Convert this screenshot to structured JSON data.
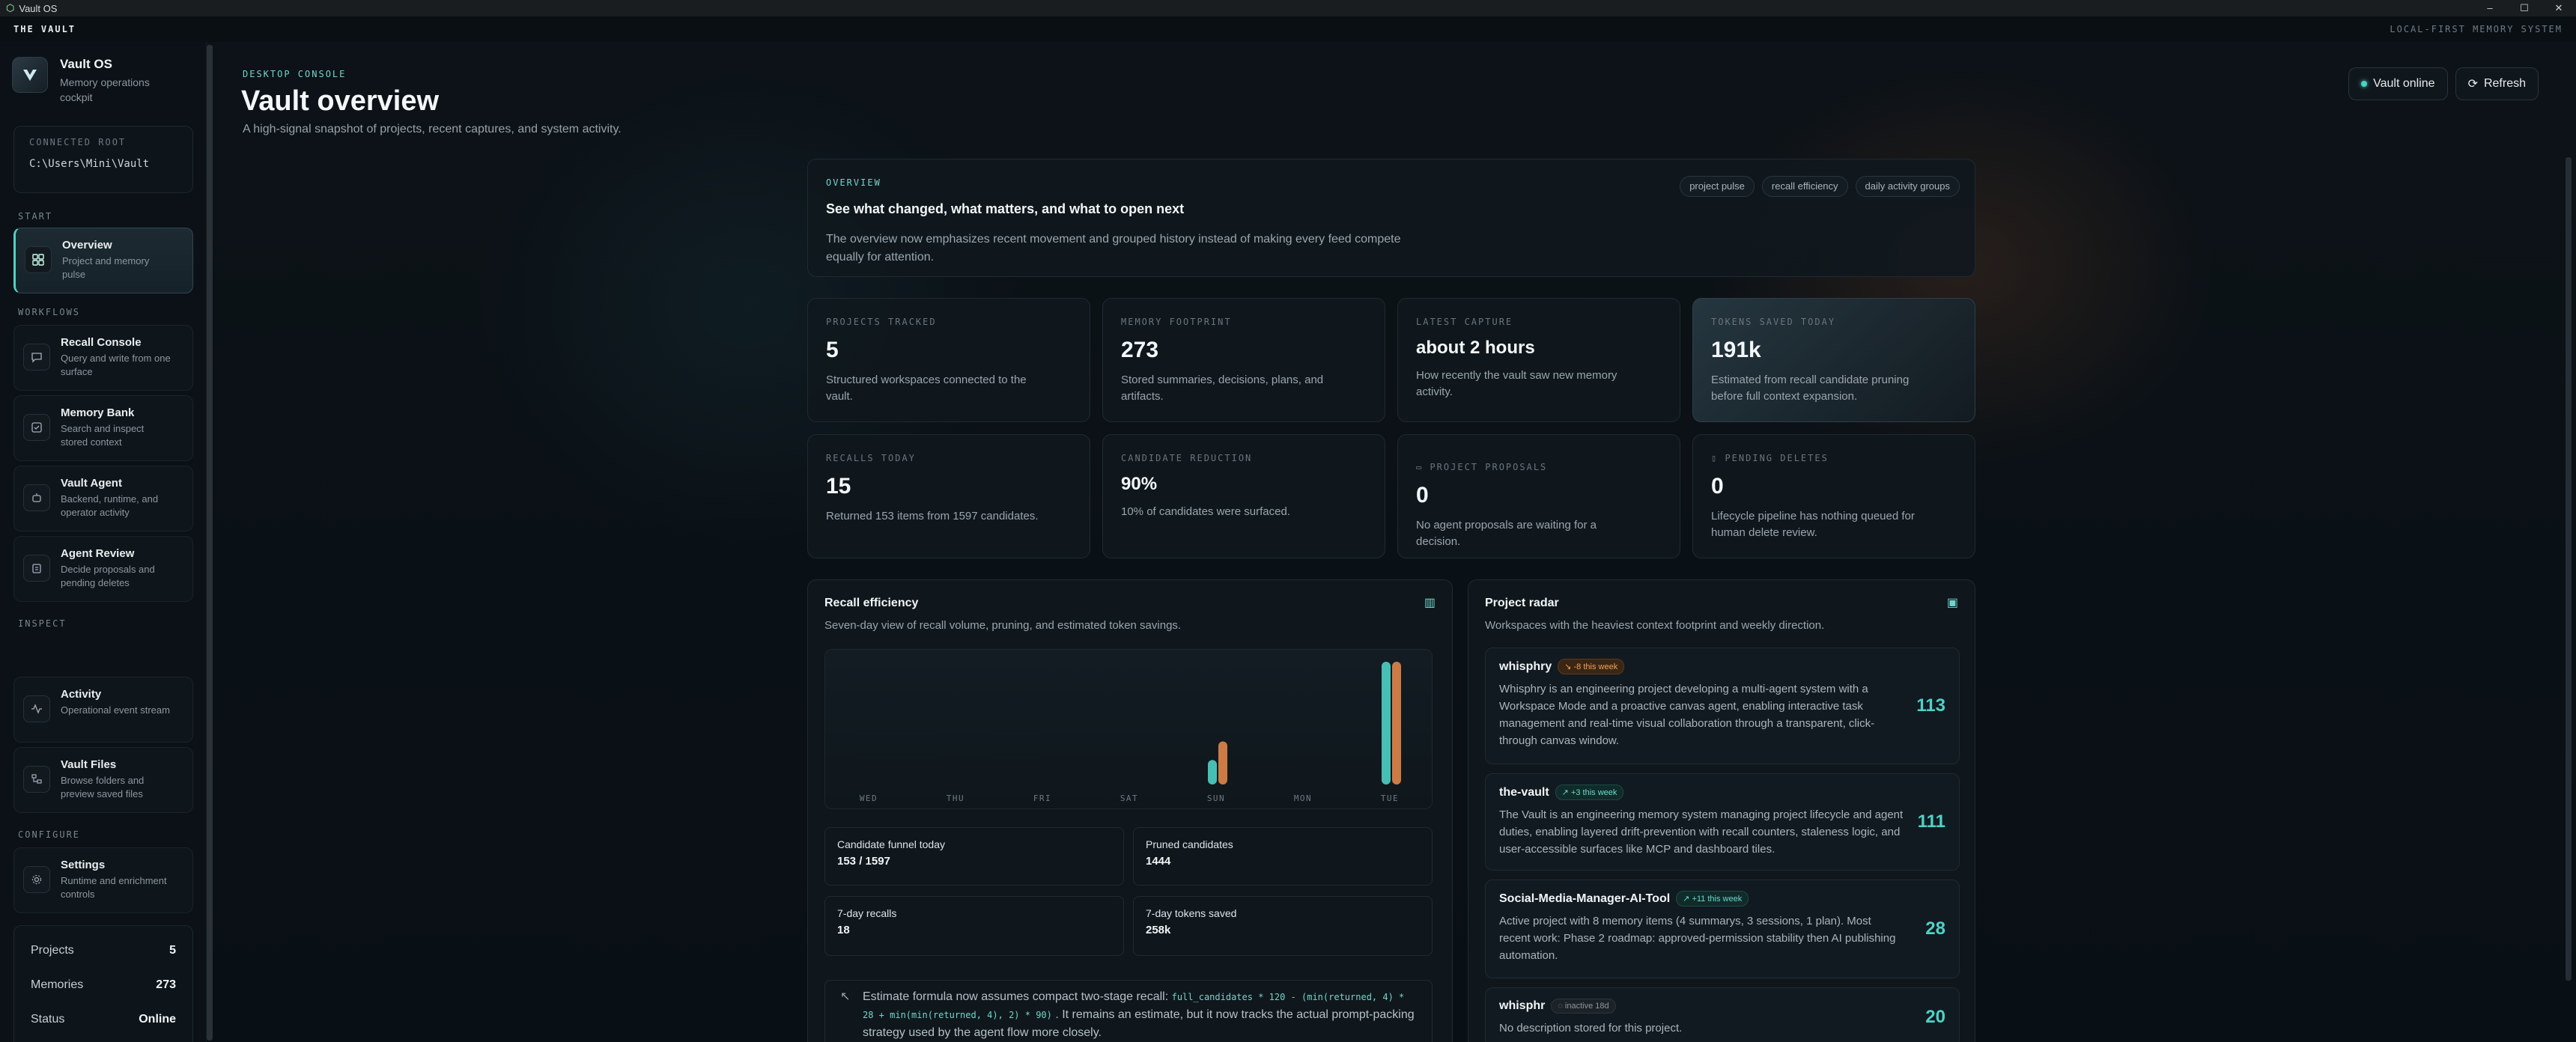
{
  "window": {
    "title": "Vault OS",
    "controls": [
      "–",
      "☐",
      "✕"
    ]
  },
  "app": {
    "brand": "THE VAULT",
    "system": "LOCAL-FIRST MEMORY SYSTEM"
  },
  "sidebar": {
    "brand": {
      "title": "Vault OS",
      "subtitle": "Memory operations cockpit"
    },
    "root": {
      "label": "CONNECTED ROOT",
      "value": "C:\\Users\\Mini\\Vault"
    },
    "sections": {
      "start": "START",
      "workflows": "WORKFLOWS",
      "inspect": "INSPECT",
      "configure": "CONFIGURE"
    },
    "items": [
      {
        "title": "Overview",
        "desc": "Project and memory pulse",
        "icon": "grid-icon"
      },
      {
        "title": "Recall Console",
        "desc": "Query and write from one surface",
        "icon": "chat-icon"
      },
      {
        "title": "Memory Bank",
        "desc": "Search and inspect stored context",
        "icon": "archive-icon"
      },
      {
        "title": "Vault Agent",
        "desc": "Backend, runtime, and operator activity",
        "icon": "bot-icon"
      },
      {
        "title": "Agent Review",
        "desc": "Decide proposals and pending deletes",
        "icon": "clipboard-icon"
      },
      {
        "title": "Activity",
        "desc": "Operational event stream",
        "icon": "activity-icon"
      },
      {
        "title": "Vault Files",
        "desc": "Browse folders and preview saved files",
        "icon": "folder-tree-icon"
      },
      {
        "title": "Settings",
        "desc": "Runtime and enrichment controls",
        "icon": "gear-icon"
      }
    ],
    "stats": [
      {
        "label": "Projects",
        "value": "5"
      },
      {
        "label": "Memories",
        "value": "273"
      },
      {
        "label": "Status",
        "value": "Online"
      }
    ]
  },
  "header": {
    "crumb": "DESKTOP CONSOLE",
    "title": "Vault overview",
    "subtitle": "A high-signal snapshot of projects, recent captures, and system activity.",
    "status": "Vault online",
    "refresh": "Refresh"
  },
  "overview": {
    "label": "OVERVIEW",
    "title": "See what changed, what matters, and what to open next",
    "desc": "The overview now emphasizes recent movement and grouped history instead of making every feed compete equally for attention.",
    "tags": [
      "project pulse",
      "recall efficiency",
      "daily activity groups"
    ]
  },
  "metrics": [
    {
      "label": "PROJECTS TRACKED",
      "value": "5",
      "desc": "Structured workspaces connected to the vault."
    },
    {
      "label": "MEMORY FOOTPRINT",
      "value": "273",
      "desc": "Stored summaries, decisions, plans, and artifacts."
    },
    {
      "label": "LATEST CAPTURE",
      "value": "about 2 hours",
      "desc": "How recently the vault saw new memory activity."
    },
    {
      "label": "TOKENS SAVED TODAY",
      "value": "191k",
      "desc": "Estimated from recall candidate pruning before full context expansion."
    },
    {
      "label": "RECALLS TODAY",
      "value": "15",
      "desc": "Returned 153 items from 1597 candidates."
    },
    {
      "label": "CANDIDATE REDUCTION",
      "value": "90%",
      "desc": "10% of candidates were surfaced."
    },
    {
      "label": "PROJECT PROPOSALS",
      "value": "0",
      "desc": "No agent proposals are waiting for a decision."
    },
    {
      "label": "PENDING DELETES",
      "value": "0",
      "desc": "Lifecycle pipeline has nothing queued for human delete review."
    }
  ],
  "recall": {
    "title": "Recall efficiency",
    "subtitle": "Seven-day view of recall volume, pruning, and estimated token savings.",
    "stats": [
      {
        "label": "Candidate funnel today",
        "value": "153 / 1597"
      },
      {
        "label": "Pruned candidates",
        "value": "1444"
      },
      {
        "label": "7-day recalls",
        "value": "18"
      },
      {
        "label": "7-day tokens saved",
        "value": "258k"
      }
    ],
    "note_pre": "Estimate formula now assumes compact two-stage recall:",
    "note_code": "full_candidates * 120 - (min(returned, 4) * 28 + min(min(returned, 4), 2) * 90)",
    "note_post": ". It remains an estimate, but it now tracks the actual prompt-packing strategy used by the agent flow more closely."
  },
  "chart_data": {
    "type": "bar",
    "categories": [
      "WED",
      "THU",
      "FRI",
      "SAT",
      "SUN",
      "MON",
      "TUE"
    ],
    "series": [
      {
        "values": [
          0,
          0,
          0,
          0,
          3,
          0,
          15
        ],
        "color": "#4fd1c5"
      },
      {
        "values": [
          0,
          0,
          0,
          0,
          67,
          0,
          191
        ],
        "color": "#e2864a"
      }
    ]
  },
  "radar": {
    "title": "Project radar",
    "subtitle": "Workspaces with the heaviest context footprint and weekly direction.",
    "projects": [
      {
        "name": "whisphry",
        "badge": "↘ -8 this week",
        "tone": "warm",
        "desc": "Whisphry is an engineering project developing a multi-agent system with a Workspace Mode and a proactive canvas agent, enabling interactive task management and real-time visual collaboration through a transparent, click-through canvas window.",
        "count": "113"
      },
      {
        "name": "the-vault",
        "badge": "↗ +3 this week",
        "tone": "teal",
        "desc": "The Vault is an engineering memory system managing project lifecycle and agent duties, enabling layered drift-prevention with recall counters, staleness logic, and user-accessible surfaces like MCP and dashboard tiles.",
        "count": "111"
      },
      {
        "name": "Social-Media-Manager-AI-Tool",
        "badge": "↗ +11 this week",
        "tone": "teal",
        "desc": "Active project with 8 memory items (4 summarys, 3 sessions, 1 plan). Most recent work: Phase 2 roadmap: approved-permission stability then AI publishing automation.",
        "count": "28"
      },
      {
        "name": "whisphr",
        "badge": "◌ inactive 18d",
        "tone": "gray",
        "desc": "No description stored for this project.",
        "count": "20"
      }
    ]
  }
}
